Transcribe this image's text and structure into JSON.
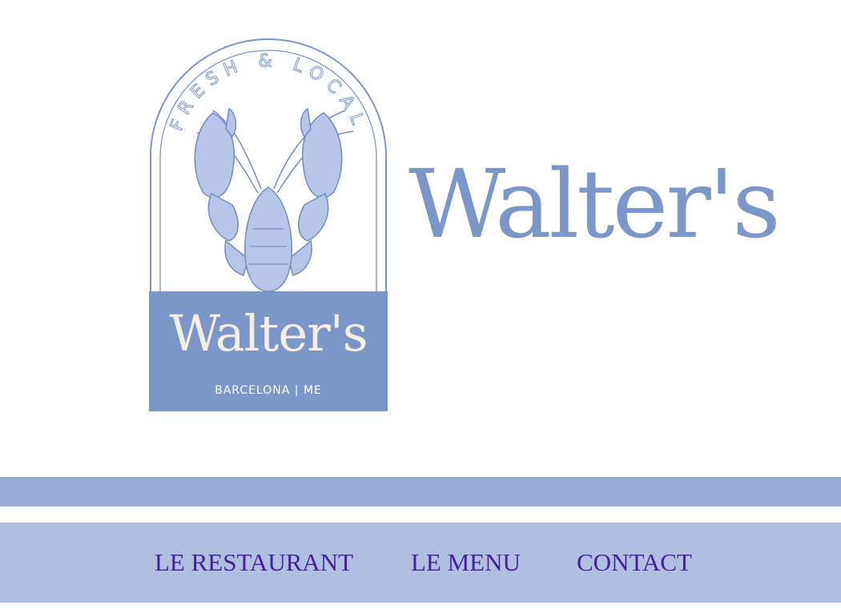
{
  "brand": {
    "name": "Walter's",
    "badge_tagline": "FRESH & LOCAL",
    "badge_name": "Walter's",
    "badge_location": "BARCELONA | ME",
    "accent_color": "#7b96c9",
    "cream_color": "#f4efe1"
  },
  "nav": {
    "items": [
      {
        "label": "LE RESTAURANT"
      },
      {
        "label": "LE MENU"
      },
      {
        "label": "CONTACT"
      }
    ],
    "link_color": "#4a1c9e",
    "background": "#aebfe0",
    "band_color": "#97abd4"
  }
}
